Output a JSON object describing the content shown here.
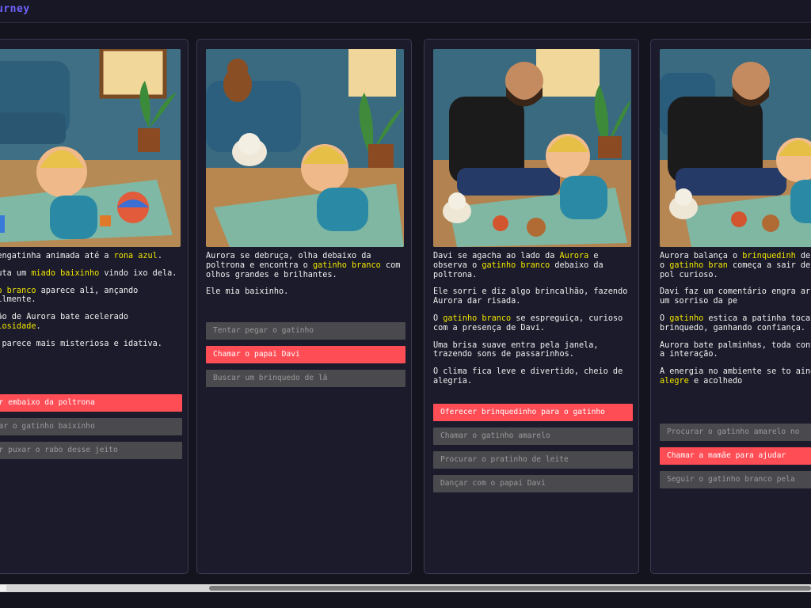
{
  "app": {
    "title": "urney"
  },
  "cards": [
    {
      "paragraphs": [
        [
          {
            "t": "ra engatinha animada até a "
          },
          {
            "t": "rona azul",
            "h": true
          },
          {
            "t": "."
          }
        ],
        [
          {
            "t": "escuta um "
          },
          {
            "t": "miado baixinho",
            "h": true
          },
          {
            "t": " vindo ixo dela."
          }
        ],
        [
          {
            "t": "rabo branco",
            "h": true
          },
          {
            "t": " aparece ali, ançando sutilmente."
          }
        ],
        [
          {
            "t": "ração de Aurora bate acelerado "
          },
          {
            "t": "curiosidade",
            "h": true
          },
          {
            "t": "."
          }
        ],
        [
          {
            "t": "ala parece mais misteriosa e idativa."
          }
        ]
      ],
      "choices": [
        {
          "label": "har embaixo da poltrona",
          "primary": true
        },
        {
          "label": "amar o gatinho baixinho",
          "primary": false
        },
        {
          "label": "tar puxar o rabo desse jeito",
          "primary": false
        }
      ]
    },
    {
      "paragraphs": [
        [
          {
            "t": "Aurora se debruça, olha debaixo da poltrona e encontra o "
          },
          {
            "t": "gatinho branco",
            "h": true
          },
          {
            "t": " com olhos grandes e brilhantes."
          }
        ],
        [
          {
            "t": "Ele mia baixinho."
          }
        ]
      ],
      "choices": [
        {
          "label": "Tentar pegar o gatinho",
          "primary": false
        },
        {
          "label": "Chamar o papai Davi",
          "primary": true
        },
        {
          "label": "Buscar um brinquedo de lã",
          "primary": false
        }
      ]
    },
    {
      "paragraphs": [
        [
          {
            "t": "Davi se agacha ao lado da "
          },
          {
            "t": "Aurora",
            "h": true
          },
          {
            "t": " e observa o "
          },
          {
            "t": "gatinho branco",
            "h": true
          },
          {
            "t": " debaixo da poltrona."
          }
        ],
        [
          {
            "t": "Ele sorri e diz algo brincalhão, fazendo Aurora dar risada."
          }
        ],
        [
          {
            "t": "O "
          },
          {
            "t": "gatinho branco",
            "h": true
          },
          {
            "t": " se espreguiça, curioso com a presença de Davi."
          }
        ],
        [
          {
            "t": "Uma brisa suave entra pela janela, trazendo sons de passarinhos."
          }
        ],
        [
          {
            "t": "O clima fica leve e divertido, cheio de alegria."
          }
        ]
      ],
      "choices": [
        {
          "label": "Oferecer brinquedinho para o gatinho",
          "primary": true
        },
        {
          "label": "Chamar o gatinho amarelo",
          "primary": false
        },
        {
          "label": "Procurar o pratinho de leite",
          "primary": false
        },
        {
          "label": "Dançar com o papai Davi",
          "primary": false
        }
      ]
    },
    {
      "paragraphs": [
        [
          {
            "t": "Aurora balança o "
          },
          {
            "t": "brinquedinh",
            "h": true
          },
          {
            "t": " delicadeza e o "
          },
          {
            "t": "gatinho bran",
            "h": true
          },
          {
            "t": " começa a sair debaixo da pol curioso."
          }
        ],
        [
          {
            "t": "Davi faz um comentário engra arrancando um sorriso da pe"
          }
        ],
        [
          {
            "t": "O "
          },
          {
            "t": "gatinho",
            "h": true
          },
          {
            "t": " estica a patinha tocar no brinquedo, ganhando confiança."
          }
        ],
        [
          {
            "t": "Aurora bate palminhas, toda contente com a interação."
          }
        ],
        [
          {
            "t": "A energia no ambiente se to ainda mais "
          },
          {
            "t": "alegre",
            "h": true
          },
          {
            "t": " e acolhedo"
          }
        ]
      ],
      "choices": [
        {
          "label": "Procurar o gatinho amarelo no",
          "primary": false
        },
        {
          "label": "Chamar a mamãe para ajudar",
          "primary": true
        },
        {
          "label": "Seguir o gatinho branco pela",
          "primary": false
        }
      ]
    }
  ],
  "colors": {
    "background": "#14141f",
    "card": "#1b1b2b",
    "highlight": "#f2e600",
    "primary_button": "#ff4d56",
    "secondary_button": "#4a4a4e",
    "brand": "#6f63ff"
  }
}
